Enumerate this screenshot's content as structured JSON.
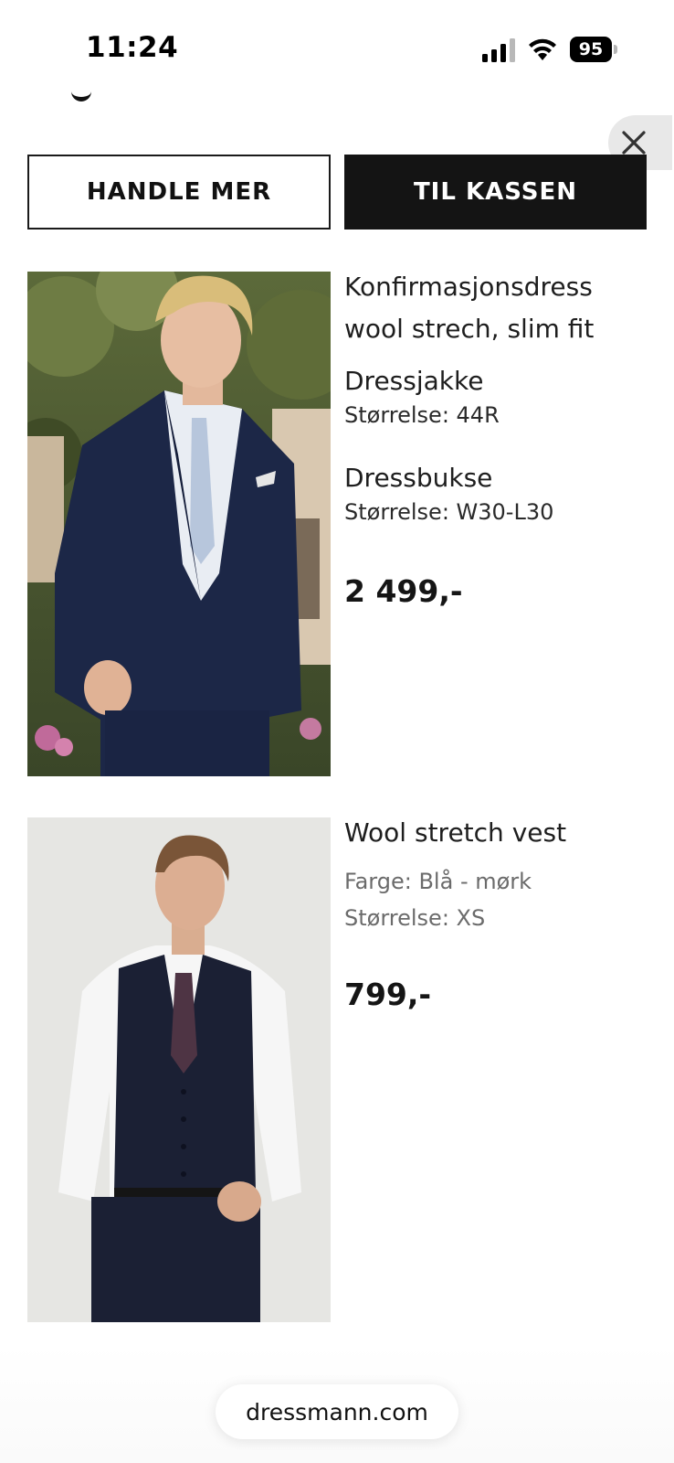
{
  "status_bar": {
    "time": "11:24",
    "battery": "95",
    "icons": [
      "signal-icon",
      "wifi-icon",
      "battery-icon"
    ]
  },
  "cart": {
    "close_icon": "close-icon",
    "continue_shopping_label": "HANDLE MER",
    "checkout_label": "TIL KASSEN",
    "items": [
      {
        "name": "Konfirmasjonsdress wool strech, slim fit",
        "parts": [
          {
            "name": "Dressjakke",
            "size": "Størrelse: 44R"
          },
          {
            "name": "Dressbukse",
            "size": "Størrelse: W30-L30"
          }
        ],
        "price": "2 499,-",
        "image_icon": "suit-photo"
      },
      {
        "name": "Wool stretch vest",
        "color": "Farge: Blå - mørk",
        "size": "Størrelse: XS",
        "price": "799,-",
        "image_icon": "vest-photo"
      }
    ]
  },
  "browser": {
    "url": "dressmann.com"
  },
  "colors": {
    "primary_button": "#141414",
    "muted_text": "#6b6b6b",
    "suit_navy": "#1c2747",
    "vest_navy": "#1b2034"
  }
}
